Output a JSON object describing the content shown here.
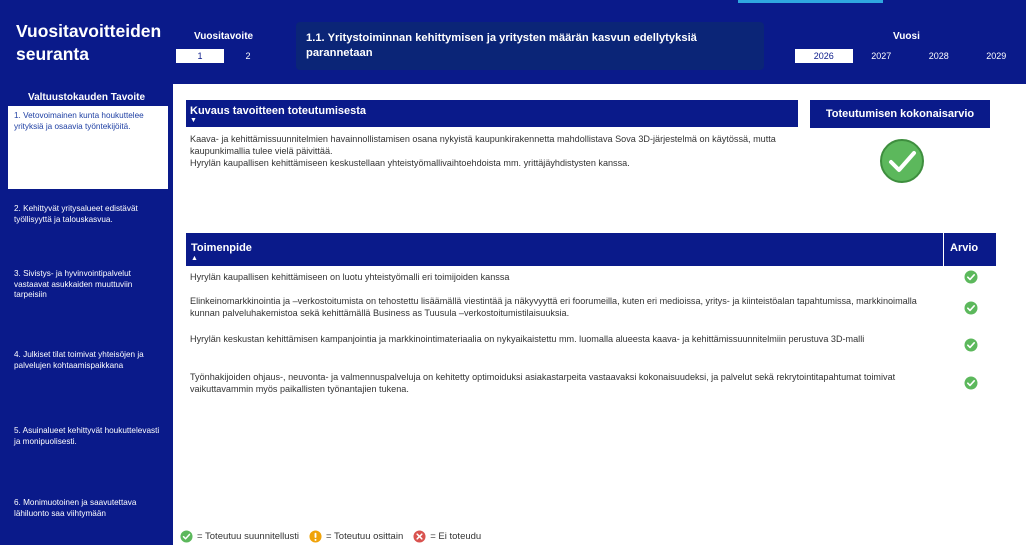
{
  "colors": {
    "navy": "#0A1A8A",
    "goal_box": "#0B2577",
    "accent": "#2FA7E0",
    "check_green": "#5CB85C",
    "partial_yellow": "#F0A30A",
    "fail_red": "#D9534F"
  },
  "header": {
    "app_title": "Vuositavoitteiden seuranta",
    "vuositavoite_label": "Vuositavoite",
    "vuositavoite_options": [
      "1",
      "2"
    ],
    "vuositavoite_selected": "1",
    "goal_title": "1.1. Yritystoiminnan kehittymisen ja yritysten määrän kasvun edellytyksiä parannetaan",
    "vuosi_label": "Vuosi",
    "years": [
      "2026",
      "2027",
      "2028",
      "2029"
    ],
    "year_selected": "2026"
  },
  "sidebar": {
    "title": "Valtuustokauden Tavoite",
    "items": [
      {
        "label": "1. Vetovoimainen kunta houkuttelee yrityksiä ja osaavia työntekijöitä.",
        "active": true
      },
      {
        "label": "2. Kehittyvät yritysalueet edistävät työllisyyttä ja talouskasvua.",
        "active": false
      },
      {
        "label": "3. Sivistys- ja hyvinvointipalvelut vastaavat asukkaiden muuttuviin tarpeisiin",
        "active": false
      },
      {
        "label": "4. Julkiset tilat toimivat yhteisöjen ja palvelujen kohtaamispaikkana",
        "active": false
      },
      {
        "label": "5. Asuinalueet kehittyvät houkuttelevasti ja monipuolisesti.",
        "active": false
      },
      {
        "label": "6. Monimuotoinen ja saavutettava lähiluonto saa viihtymään",
        "active": false
      }
    ]
  },
  "description": {
    "header": "Kuvaus tavoitteen toteutumisesta",
    "sort_arrow": "▼",
    "lines": [
      "Kaava- ja kehittämissuunnitelmien havainnollistamisen osana nykyistä kaupunkirakennetta mahdollistava Sova 3D-järjestelmä on käytössä, mutta kaupunkimallia tulee vielä päivittää.",
      "Hyrylän kaupallisen kehittämiseen keskustellaan yhteistyömallivaihtoehdoista mm. yrittäjäyhdistysten kanssa."
    ]
  },
  "overall": {
    "header": "Toteutumisen kokonaisarvio",
    "status_icon": "check-circle-icon"
  },
  "actions": {
    "col_action": "Toimenpide",
    "col_rating": "Arvio",
    "sort_arrow": "▲",
    "rows": [
      {
        "text": "Hyrylän kaupallisen kehittämiseen on luotu yhteistyömalli eri toimijoiden kanssa",
        "status": "check"
      },
      {
        "text": "Elinkeinomarkkinointia ja –verkostoitumista on tehostettu lisäämällä viestintää ja näkyvyyttä eri foorumeilla, kuten eri medioissa, yritys- ja kiinteistöalan tapahtumissa, markkinoimalla kunnan palveluhakemistoa sekä kehittämällä Business as Tuusula –verkostoitumistilaisuuksia.",
        "status": "check"
      },
      {
        "text": "Hyrylän keskustan kehittämisen kampanjointia ja markkinointimateriaalia on nykyaikaistettu mm. luomalla alueesta kaava- ja kehittämissuunnitelmiin perustuva 3D-malli",
        "status": "check"
      },
      {
        "text": "Työnhakijoiden ohjaus-, neuvonta- ja valmennuspalveluja on kehitetty optimoiduksi asiakastarpeita vastaavaksi kokonaisuudeksi, ja palvelut sekä rekrytointitapahtumat toimivat vaikuttavammin myös paikallisten työnantajien tukena.",
        "status": "check"
      }
    ]
  },
  "legend": {
    "items": [
      {
        "icon": "check-circle-icon",
        "text": "= Toteutuu suunnitellusti"
      },
      {
        "icon": "exclamation-circle-icon",
        "text": "= Toteutuu osittain"
      },
      {
        "icon": "x-circle-icon",
        "text": "= Ei toteudu"
      }
    ]
  }
}
